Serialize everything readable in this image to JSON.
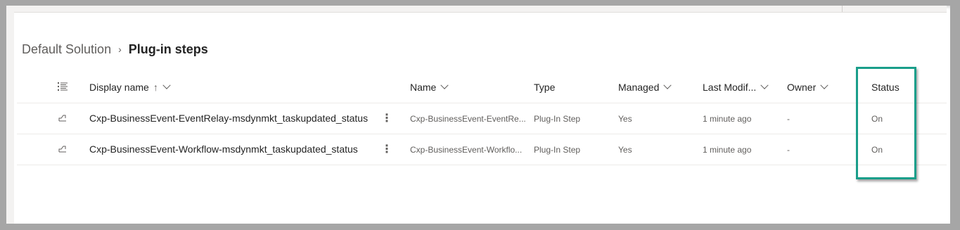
{
  "breadcrumb": {
    "parent": "Default Solution",
    "separator": "›",
    "current": "Plug-in steps"
  },
  "columns": {
    "display_name": "Display name",
    "sort_arrow": "↑",
    "name": "Name",
    "type": "Type",
    "managed": "Managed",
    "last_modified": "Last Modif...",
    "owner": "Owner",
    "status": "Status"
  },
  "rows": [
    {
      "display_name": "Cxp-BusinessEvent-EventRelay-msdynmkt_taskupdated_status",
      "more": "⋮",
      "name": "Cxp-BusinessEvent-EventRe...",
      "type": "Plug-In Step",
      "managed": "Yes",
      "last_modified": "1 minute ago",
      "owner": "-",
      "status": "On"
    },
    {
      "display_name": "Cxp-BusinessEvent-Workflow-msdynmkt_taskupdated_status",
      "more": "⋮",
      "name": "Cxp-BusinessEvent-Workflo...",
      "type": "Plug-In Step",
      "managed": "Yes",
      "last_modified": "1 minute ago",
      "owner": "-",
      "status": "On"
    }
  ],
  "icons": {
    "column_options": "list-options-icon",
    "row": "plugin-step-icon"
  },
  "colors": {
    "highlight": "#1a9e8a",
    "text": "#242424",
    "muted": "#605e5c"
  }
}
